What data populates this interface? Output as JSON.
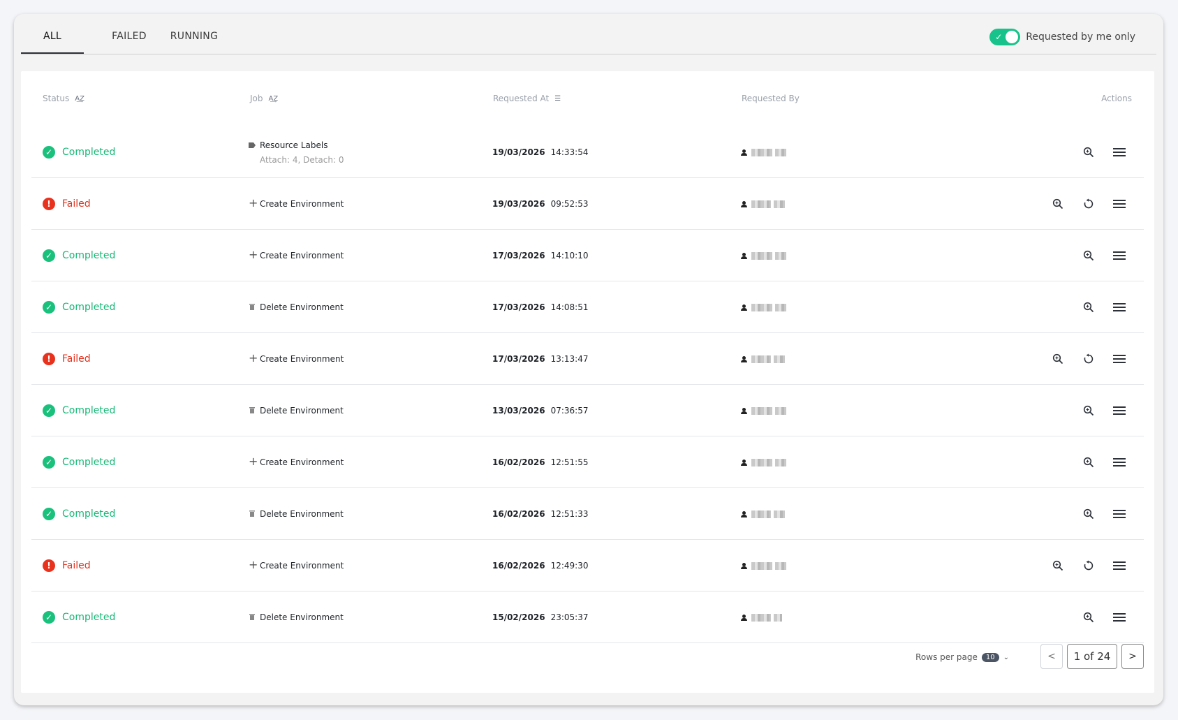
{
  "tabs": [
    {
      "label": "ALL",
      "active": true
    },
    {
      "label": "FAILED",
      "active": false
    },
    {
      "label": "RUNNING",
      "active": false
    }
  ],
  "toggle": {
    "label": "Requested by me only",
    "on": true,
    "accent": "#17c38a"
  },
  "table": {
    "headers": {
      "status": "Status",
      "job": "Job",
      "requested_at": "Requested At",
      "requested_by": "Requested By",
      "actions": "Actions"
    },
    "rows": [
      {
        "status": "Completed",
        "job_icon": "tag-icon",
        "job": "Resource Labels",
        "job_sub": "Attach: 4, Detach: 0",
        "date": "19/03/2026",
        "time": "14:33:54",
        "retry": false
      },
      {
        "status": "Failed",
        "job_icon": "plus-icon",
        "job": "Create Environment",
        "job_sub": "",
        "date": "19/03/2026",
        "time": "09:52:53",
        "retry": true
      },
      {
        "status": "Completed",
        "job_icon": "plus-icon",
        "job": "Create Environment",
        "job_sub": "",
        "date": "17/03/2026",
        "time": "14:10:10",
        "retry": false
      },
      {
        "status": "Completed",
        "job_icon": "trash-icon",
        "job": "Delete Environment",
        "job_sub": "",
        "date": "17/03/2026",
        "time": "14:08:51",
        "retry": false
      },
      {
        "status": "Failed",
        "job_icon": "plus-icon",
        "job": "Create Environment",
        "job_sub": "",
        "date": "17/03/2026",
        "time": "13:13:47",
        "retry": true
      },
      {
        "status": "Completed",
        "job_icon": "trash-icon",
        "job": "Delete Environment",
        "job_sub": "",
        "date": "13/03/2026",
        "time": "07:36:57",
        "retry": false
      },
      {
        "status": "Completed",
        "job_icon": "plus-icon",
        "job": "Create Environment",
        "job_sub": "",
        "date": "16/02/2026",
        "time": "12:51:55",
        "retry": false
      },
      {
        "status": "Completed",
        "job_icon": "trash-icon",
        "job": "Delete Environment",
        "job_sub": "",
        "date": "16/02/2026",
        "time": "12:51:33",
        "retry": false
      },
      {
        "status": "Failed",
        "job_icon": "plus-icon",
        "job": "Create Environment",
        "job_sub": "",
        "date": "16/02/2026",
        "time": "12:49:30",
        "retry": true
      },
      {
        "status": "Completed",
        "job_icon": "trash-icon",
        "job": "Delete Environment",
        "job_sub": "",
        "date": "15/02/2026",
        "time": "23:05:37",
        "retry": false
      }
    ]
  },
  "pagination": {
    "rows_per_page_label": "Rows per page",
    "rows_per_page": "10",
    "prev": "<",
    "next": ">",
    "page_text": "1 of 24"
  },
  "colors": {
    "completed": "#19c17d",
    "failed": "#e9321e"
  }
}
